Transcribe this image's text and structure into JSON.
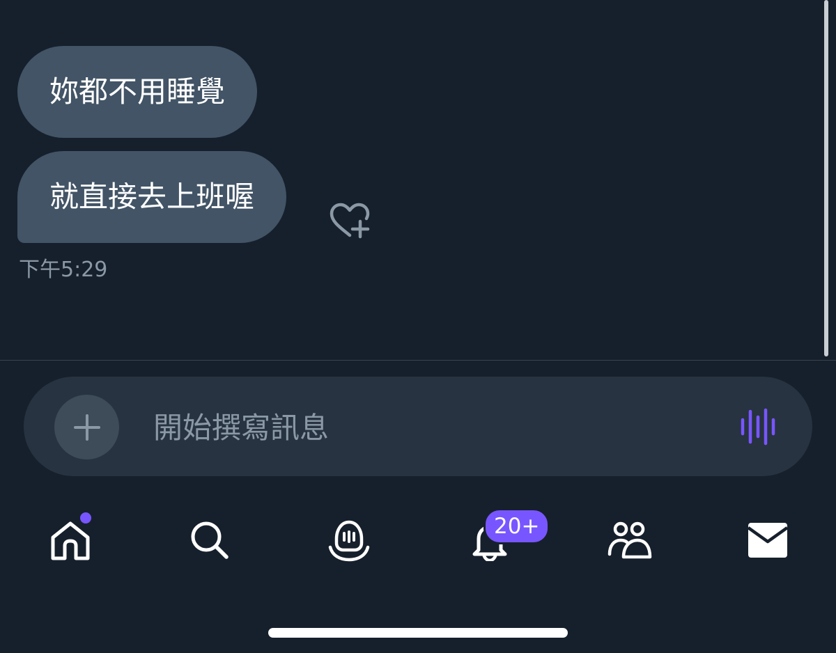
{
  "conversation": {
    "messages": [
      {
        "text": "妳都不用睡覺"
      },
      {
        "text": "就直接去上班喔"
      }
    ],
    "timestamp": "下午5:29"
  },
  "composer": {
    "placeholder": "開始撰寫訊息",
    "accent_color": "#7856ff"
  },
  "nav": {
    "items": [
      {
        "icon": "home-icon",
        "has_dot": true
      },
      {
        "icon": "search-icon"
      },
      {
        "icon": "spaces-icon"
      },
      {
        "icon": "bell-icon",
        "badge": "20+"
      },
      {
        "icon": "communities-icon"
      },
      {
        "icon": "mail-icon"
      }
    ],
    "notification_badge": "20+"
  },
  "colors": {
    "background": "#16202c",
    "bubble": "#425466",
    "composer": "#273340",
    "accent": "#7856ff"
  }
}
